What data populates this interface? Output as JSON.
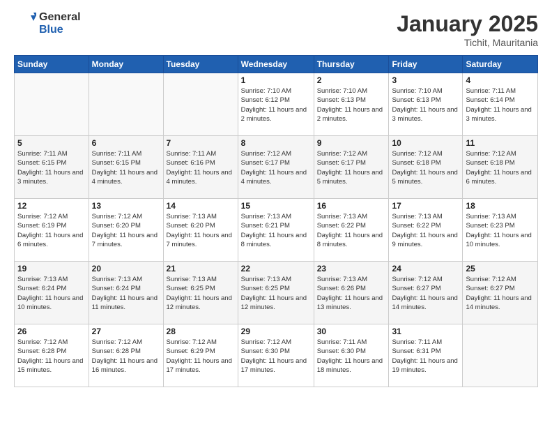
{
  "header": {
    "title": "January 2025",
    "subtitle": "Tichit, Mauritania"
  },
  "columns": [
    "Sunday",
    "Monday",
    "Tuesday",
    "Wednesday",
    "Thursday",
    "Friday",
    "Saturday"
  ],
  "weeks": [
    [
      {
        "day": "",
        "info": ""
      },
      {
        "day": "",
        "info": ""
      },
      {
        "day": "",
        "info": ""
      },
      {
        "day": "1",
        "info": "Sunrise: 7:10 AM\nSunset: 6:12 PM\nDaylight: 11 hours\nand 2 minutes."
      },
      {
        "day": "2",
        "info": "Sunrise: 7:10 AM\nSunset: 6:13 PM\nDaylight: 11 hours\nand 2 minutes."
      },
      {
        "day": "3",
        "info": "Sunrise: 7:10 AM\nSunset: 6:13 PM\nDaylight: 11 hours\nand 3 minutes."
      },
      {
        "day": "4",
        "info": "Sunrise: 7:11 AM\nSunset: 6:14 PM\nDaylight: 11 hours\nand 3 minutes."
      }
    ],
    [
      {
        "day": "5",
        "info": "Sunrise: 7:11 AM\nSunset: 6:15 PM\nDaylight: 11 hours\nand 3 minutes."
      },
      {
        "day": "6",
        "info": "Sunrise: 7:11 AM\nSunset: 6:15 PM\nDaylight: 11 hours\nand 4 minutes."
      },
      {
        "day": "7",
        "info": "Sunrise: 7:11 AM\nSunset: 6:16 PM\nDaylight: 11 hours\nand 4 minutes."
      },
      {
        "day": "8",
        "info": "Sunrise: 7:12 AM\nSunset: 6:17 PM\nDaylight: 11 hours\nand 4 minutes."
      },
      {
        "day": "9",
        "info": "Sunrise: 7:12 AM\nSunset: 6:17 PM\nDaylight: 11 hours\nand 5 minutes."
      },
      {
        "day": "10",
        "info": "Sunrise: 7:12 AM\nSunset: 6:18 PM\nDaylight: 11 hours\nand 5 minutes."
      },
      {
        "day": "11",
        "info": "Sunrise: 7:12 AM\nSunset: 6:18 PM\nDaylight: 11 hours\nand 6 minutes."
      }
    ],
    [
      {
        "day": "12",
        "info": "Sunrise: 7:12 AM\nSunset: 6:19 PM\nDaylight: 11 hours\nand 6 minutes."
      },
      {
        "day": "13",
        "info": "Sunrise: 7:12 AM\nSunset: 6:20 PM\nDaylight: 11 hours\nand 7 minutes."
      },
      {
        "day": "14",
        "info": "Sunrise: 7:13 AM\nSunset: 6:20 PM\nDaylight: 11 hours\nand 7 minutes."
      },
      {
        "day": "15",
        "info": "Sunrise: 7:13 AM\nSunset: 6:21 PM\nDaylight: 11 hours\nand 8 minutes."
      },
      {
        "day": "16",
        "info": "Sunrise: 7:13 AM\nSunset: 6:22 PM\nDaylight: 11 hours\nand 8 minutes."
      },
      {
        "day": "17",
        "info": "Sunrise: 7:13 AM\nSunset: 6:22 PM\nDaylight: 11 hours\nand 9 minutes."
      },
      {
        "day": "18",
        "info": "Sunrise: 7:13 AM\nSunset: 6:23 PM\nDaylight: 11 hours\nand 10 minutes."
      }
    ],
    [
      {
        "day": "19",
        "info": "Sunrise: 7:13 AM\nSunset: 6:24 PM\nDaylight: 11 hours\nand 10 minutes."
      },
      {
        "day": "20",
        "info": "Sunrise: 7:13 AM\nSunset: 6:24 PM\nDaylight: 11 hours\nand 11 minutes."
      },
      {
        "day": "21",
        "info": "Sunrise: 7:13 AM\nSunset: 6:25 PM\nDaylight: 11 hours\nand 12 minutes."
      },
      {
        "day": "22",
        "info": "Sunrise: 7:13 AM\nSunset: 6:25 PM\nDaylight: 11 hours\nand 12 minutes."
      },
      {
        "day": "23",
        "info": "Sunrise: 7:13 AM\nSunset: 6:26 PM\nDaylight: 11 hours\nand 13 minutes."
      },
      {
        "day": "24",
        "info": "Sunrise: 7:12 AM\nSunset: 6:27 PM\nDaylight: 11 hours\nand 14 minutes."
      },
      {
        "day": "25",
        "info": "Sunrise: 7:12 AM\nSunset: 6:27 PM\nDaylight: 11 hours\nand 14 minutes."
      }
    ],
    [
      {
        "day": "26",
        "info": "Sunrise: 7:12 AM\nSunset: 6:28 PM\nDaylight: 11 hours\nand 15 minutes."
      },
      {
        "day": "27",
        "info": "Sunrise: 7:12 AM\nSunset: 6:28 PM\nDaylight: 11 hours\nand 16 minutes."
      },
      {
        "day": "28",
        "info": "Sunrise: 7:12 AM\nSunset: 6:29 PM\nDaylight: 11 hours\nand 17 minutes."
      },
      {
        "day": "29",
        "info": "Sunrise: 7:12 AM\nSunset: 6:30 PM\nDaylight: 11 hours\nand 17 minutes."
      },
      {
        "day": "30",
        "info": "Sunrise: 7:11 AM\nSunset: 6:30 PM\nDaylight: 11 hours\nand 18 minutes."
      },
      {
        "day": "31",
        "info": "Sunrise: 7:11 AM\nSunset: 6:31 PM\nDaylight: 11 hours\nand 19 minutes."
      },
      {
        "day": "",
        "info": ""
      }
    ]
  ]
}
